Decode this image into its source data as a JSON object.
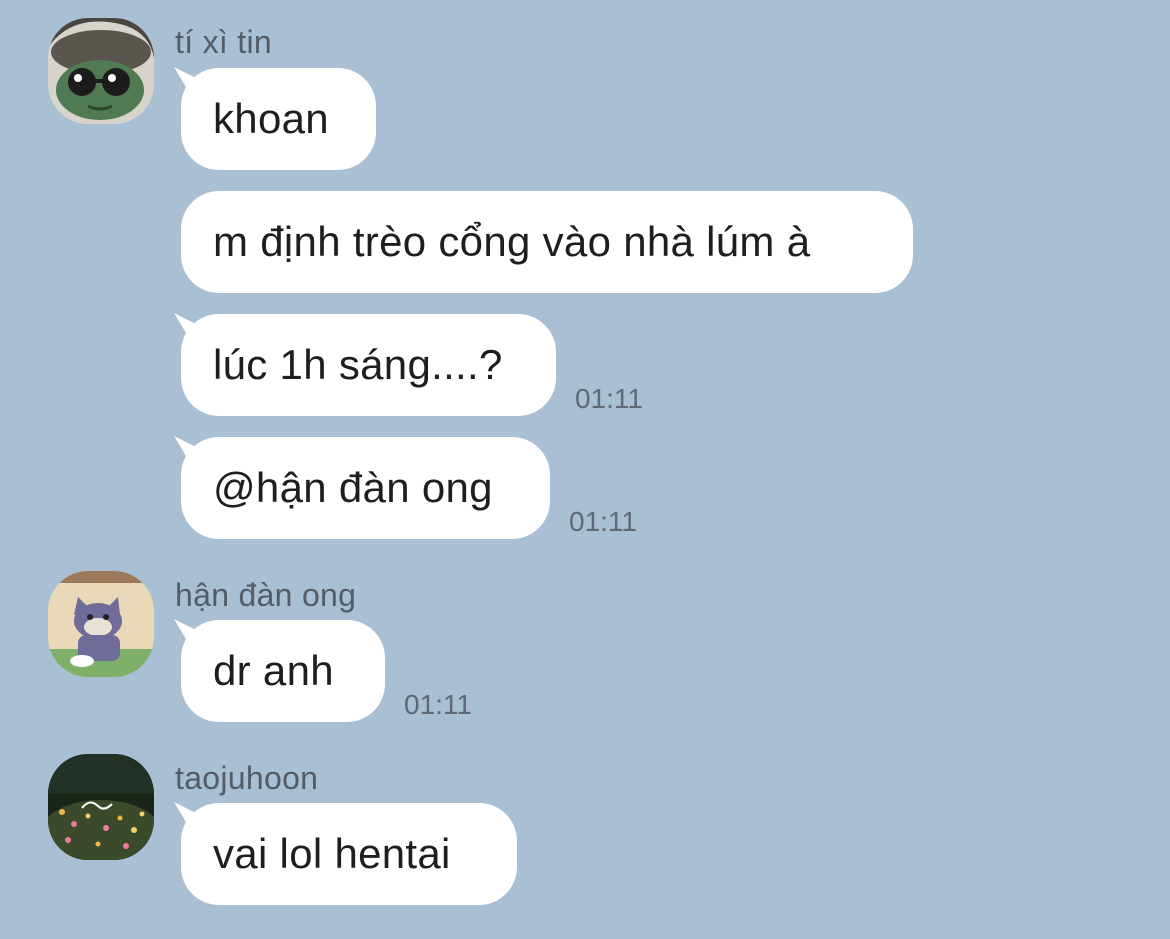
{
  "chat": {
    "groups": [
      {
        "sender": "tí xì tin",
        "avatar": "turtle-avatar",
        "messages": [
          {
            "text": "khoan",
            "time": ""
          },
          {
            "text": "m định trèo cổng vào nhà lúm à",
            "time": ""
          },
          {
            "text": "lúc 1h sáng....?",
            "time": "01:11"
          },
          {
            "text": "@hận đàn ong",
            "time": "01:11"
          }
        ]
      },
      {
        "sender": "hận đàn ong",
        "avatar": "tom-cat-avatar",
        "messages": [
          {
            "text": "dr anh",
            "time": "01:11"
          }
        ]
      },
      {
        "sender": "taojuhoon",
        "avatar": "flower-field-avatar",
        "messages": [
          {
            "text": "vai lol hentai",
            "time": ""
          }
        ]
      }
    ]
  },
  "colors": {
    "background": "#a9bfd3",
    "bubble": "#ffffff",
    "name_text": "#535d68",
    "time_text": "#5f6a76"
  }
}
